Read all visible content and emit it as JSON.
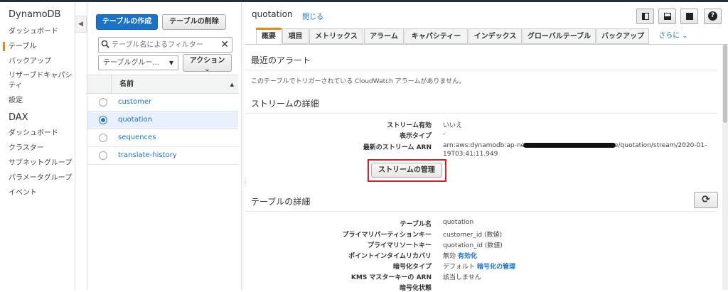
{
  "nav": {
    "dynamodb": "DynamoDB",
    "items": [
      "ダッシュボード",
      "テーブル",
      "バックアップ",
      "リザーブドキャパシティ",
      "設定"
    ],
    "dax": "DAX",
    "dax_items": [
      "ダッシュボード",
      "クラスター",
      "サブネットグループ",
      "パラメータグループ",
      "イベント"
    ]
  },
  "list": {
    "create_button": "テーブルの作成",
    "delete_button": "テーブルの削除",
    "filter_placeholder": "テーブル名によるフィルター",
    "group_select": "テーブルグルー...",
    "action_button": "アクション",
    "column_name": "名前",
    "tables": [
      "customer",
      "quotation",
      "sequences",
      "translate-history"
    ],
    "selected": "quotation"
  },
  "detail": {
    "title": "quotation",
    "close": "閉じる",
    "tabs": [
      "概要",
      "項目",
      "メトリックス",
      "アラーム",
      "キャパシティー",
      "インデックス",
      "グローバルテーブル",
      "バックアップ"
    ],
    "more": "さらに ⌄",
    "alarms_heading": "最近のアラート",
    "alarms_note": "このテーブルでトリガーされている CloudWatch アラームがありません。",
    "stream_heading": "ストリームの詳細",
    "stream": {
      "enabled_label": "ストリーム有効",
      "enabled_value": "いいえ",
      "view_type_label": "表示タイプ",
      "view_type_value": "-",
      "arn_label": "最新のストリーム ARN",
      "arn_prefix": "arn:aws:dynamodb:ap-ne",
      "arn_suffix": "e/quotation/stream/2020-01-",
      "arn_line2": "19T03:41:11.949"
    },
    "manage_stream_button": "ストリームの管理",
    "table_heading": "テーブルの詳細",
    "table": {
      "name_label": "テーブル名",
      "name_value": "quotation",
      "pk_label": "プライマリパーティションキー",
      "pk_value": "customer_id (数値)",
      "sk_label": "プライマリソートキー",
      "sk_value": "quotation_id (数値)",
      "pitr_label": "ポイントインタイムリカバリ",
      "pitr_value": "無効",
      "pitr_link": "有効化",
      "enc_label": "暗号化タイプ",
      "enc_value": "デフォルト",
      "enc_link": "暗号化の管理",
      "kms_label": "KMS マスターキーの ARN",
      "kms_value": "該当しません",
      "enc_status_label": "暗号化状態"
    }
  }
}
